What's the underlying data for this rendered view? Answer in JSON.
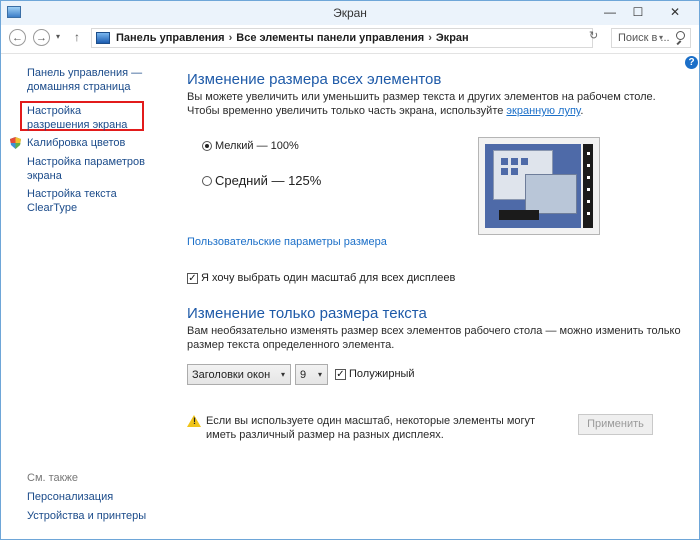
{
  "window": {
    "title": "Экран",
    "min": "—",
    "max": "☐",
    "close": "✕"
  },
  "nav": {
    "back": "←",
    "forward": "→",
    "recent": "▾",
    "up": "↑",
    "breadcrumbs": [
      "Панель управления",
      "Все элементы панели управления",
      "Экран"
    ],
    "breadcrumb_sep": "›",
    "dropdown": "▾",
    "refresh": "↻",
    "search_placeholder": "Поиск в ..."
  },
  "help": "?",
  "sidebar": {
    "home": "Панель управления — домашняя страница",
    "items": [
      "Настройка разрешения экрана",
      "Калибровка цветов",
      "Настройка параметров экрана",
      "Настройка текста ClearType"
    ],
    "see_also_title": "См. также",
    "see_also": [
      "Персонализация",
      "Устройства и принтеры"
    ]
  },
  "main": {
    "size_heading": "Изменение размера всех элементов",
    "size_text": "Вы можете увеличить или уменьшить размер текста и других элементов на рабочем столе. Чтобы временно увеличить только часть экрана, используйте ",
    "size_link": "экранную лупу",
    "size_text_end": ".",
    "radio_options": [
      {
        "label": "Мелкий — 100%",
        "selected": true
      },
      {
        "label": "Средний — 125%",
        "selected": false
      }
    ],
    "custom_link": "Пользовательские параметры размера",
    "one_scale_checkbox": {
      "label": "Я хочу выбрать один масштаб для всех дисплеев",
      "checked": true,
      "mark": "✓"
    },
    "text_heading": "Изменение только размера текста",
    "text_text": "Вам необязательно изменять размер всех элементов рабочего стола — можно изменить только размер текста определенного элемента.",
    "element_select": "Заголовки окон",
    "size_select": "9",
    "select_arrow": "▾",
    "bold_checkbox": {
      "label": "Полужирный",
      "checked": true,
      "mark": "✓"
    },
    "warning_text": "Если вы используете один масштаб, некоторые элементы могут иметь различный размер на разных дисплеях.",
    "warning_mark": "!",
    "apply_button": "Применить"
  },
  "colors": {
    "heading": "#1e5aa8",
    "link": "#1b6fc8",
    "highlight": "#e21b1b",
    "warning": "#f0c419"
  },
  "icons": [
    "back-arrow-icon",
    "forward-arrow-icon",
    "up-arrow-icon",
    "control-panel-icon",
    "refresh-icon",
    "search-icon",
    "help-icon",
    "shield-icon",
    "warning-icon",
    "display-preview-icon"
  ]
}
